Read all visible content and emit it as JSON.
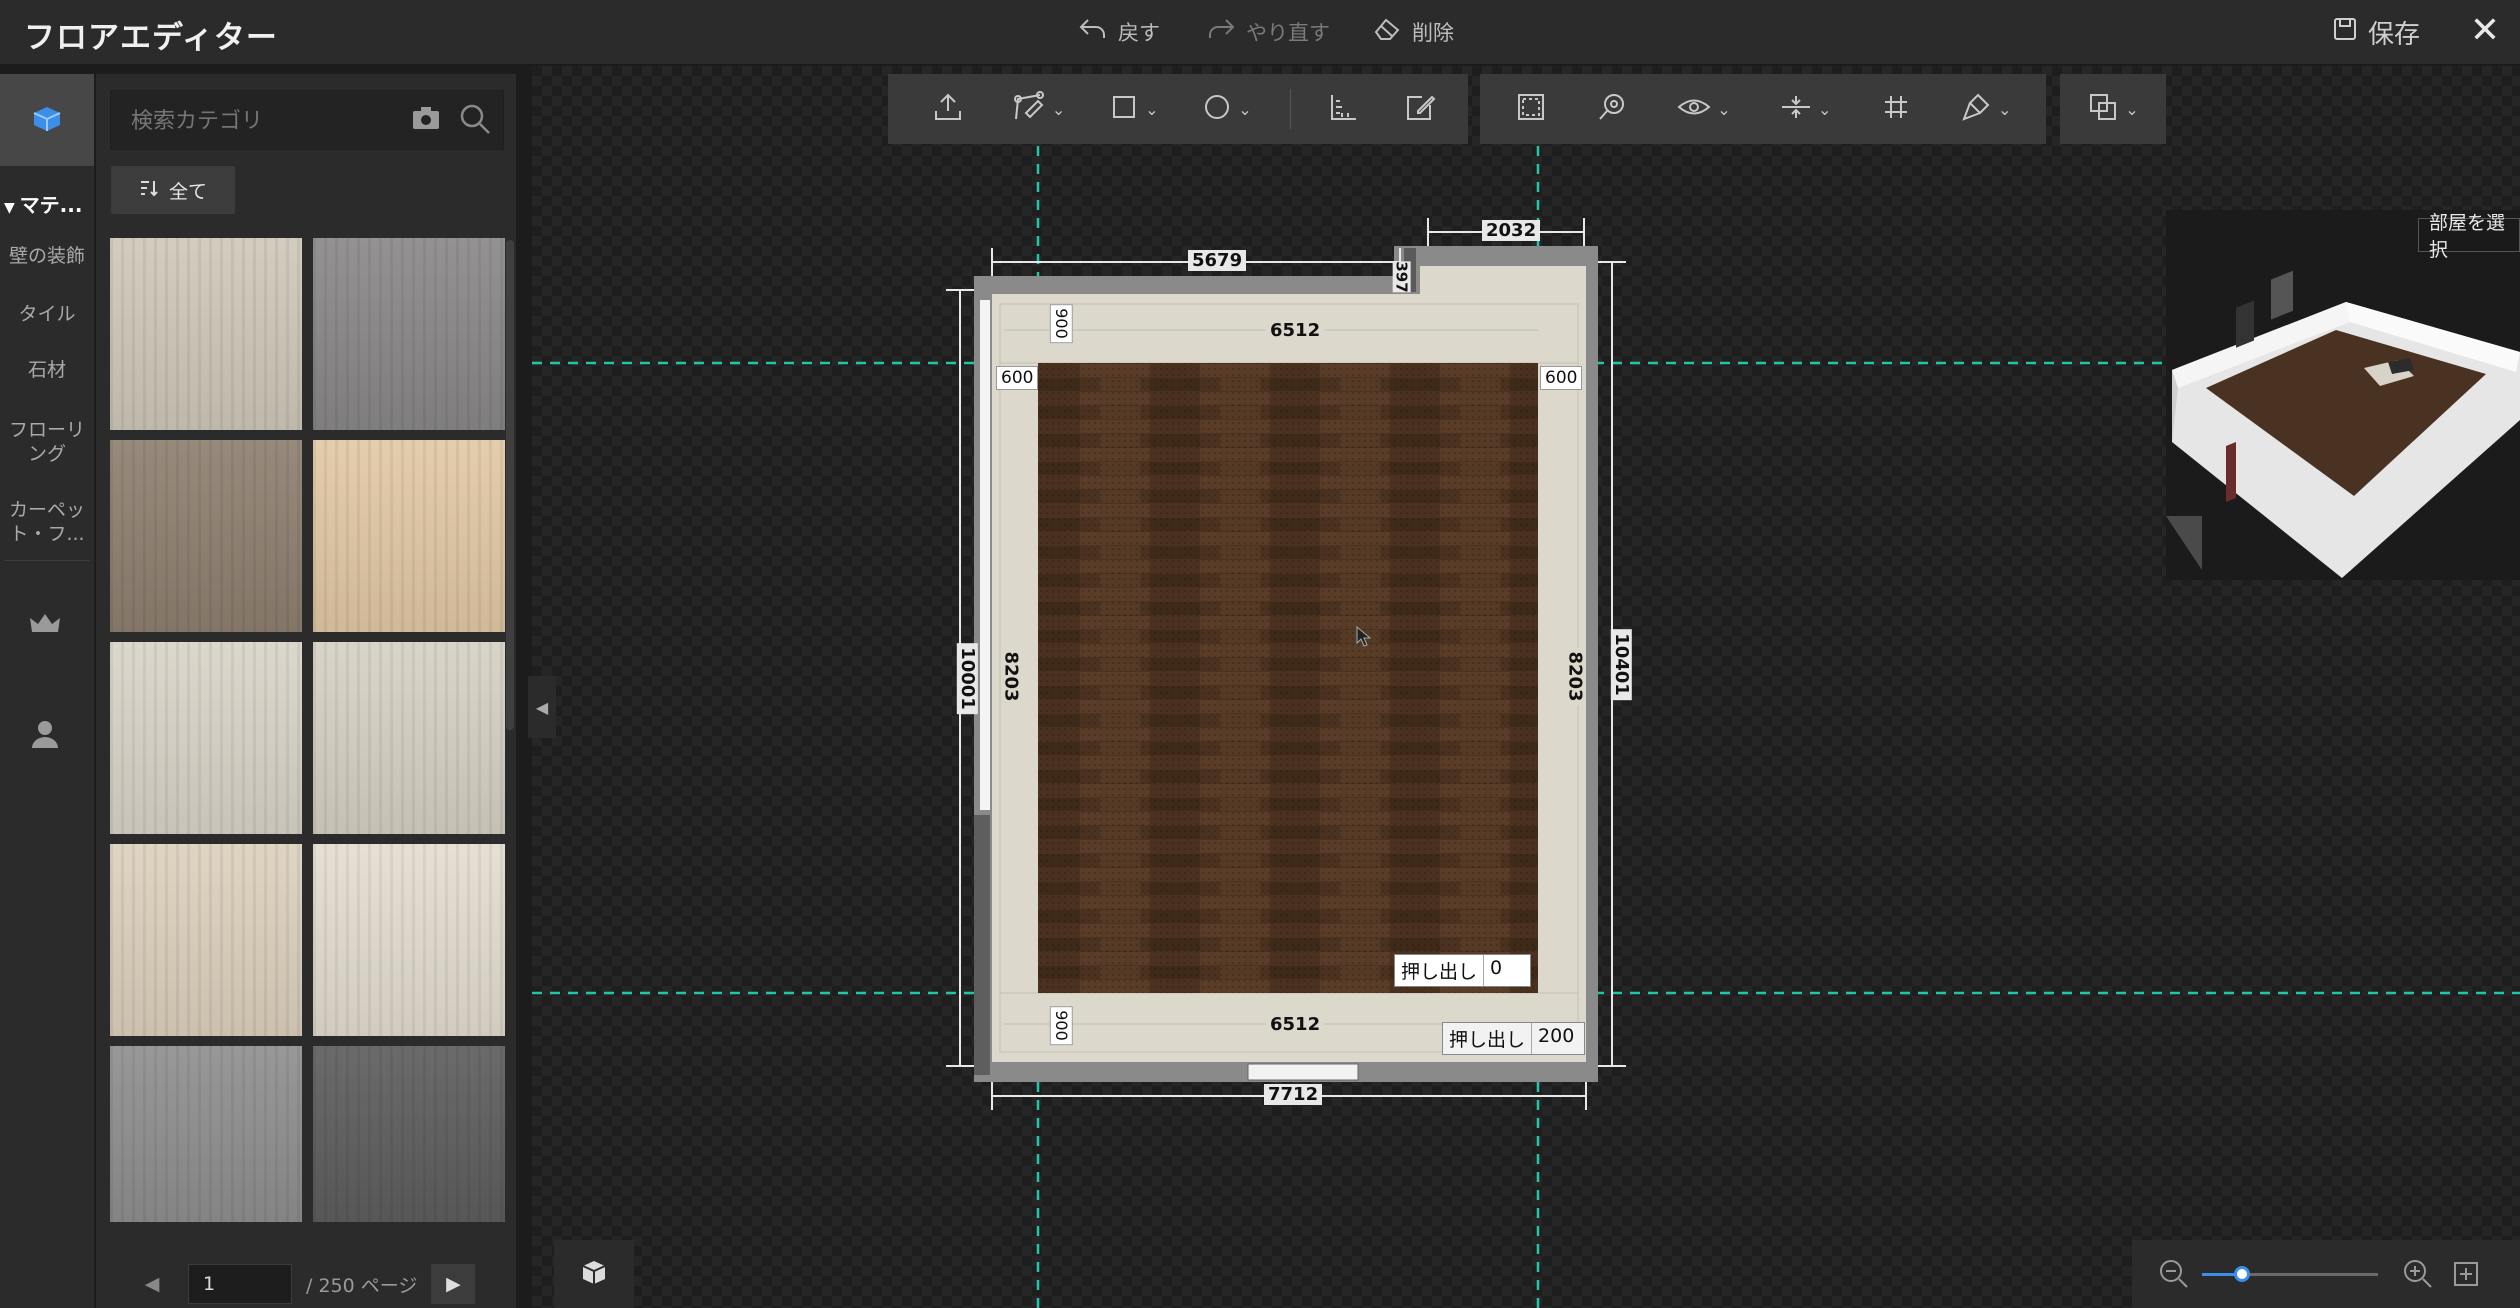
{
  "app": {
    "title": "フロアエディター"
  },
  "topbar": {
    "undo": "戻す",
    "redo": "やり直す",
    "delete": "削除",
    "save": "保存",
    "close": "✕"
  },
  "sidebar": {
    "categories": [
      {
        "label": "マテ..."
      },
      {
        "label": "壁の装飾"
      },
      {
        "label": "タイル"
      },
      {
        "label": "石材"
      },
      {
        "label": "フローリ\nング"
      },
      {
        "label": "カーペッ\nト・フ..."
      }
    ]
  },
  "materials": {
    "search_placeholder": "検索カテゴリ",
    "filter_label": "全て",
    "tiles": [
      {
        "name": "light-wood",
        "color": "#cfc8ba"
      },
      {
        "name": "gray-fabric",
        "color": "#8a8888"
      },
      {
        "name": "rustic-wood",
        "color": "#8e8070"
      },
      {
        "name": "birch-wood",
        "color": "#e2c9a5"
      },
      {
        "name": "beige-marble",
        "color": "#d9d4c8"
      },
      {
        "name": "pale-wood",
        "color": "#d6d1c4"
      },
      {
        "name": "travertine",
        "color": "#ddd0bd"
      },
      {
        "name": "check-tile",
        "color": "#e4ddd0"
      },
      {
        "name": "gray-stone",
        "color": "#8f8f8f"
      },
      {
        "name": "dark-check",
        "color": "#5e5e5e"
      }
    ],
    "page_current": "1",
    "page_total": "/ 250 ページ"
  },
  "plan": {
    "dims": {
      "top_left": "5679",
      "top_right": "2032",
      "notch": "397",
      "inner_top": "6512",
      "inner_bottom": "6512",
      "bottom": "7712",
      "left_outer": "10001",
      "right_outer": "10401",
      "left_inner": "8203",
      "right_inner": "8203",
      "left_offset": "600",
      "right_offset": "600",
      "top_offset": "900",
      "bottom_offset": "900"
    },
    "extrude_label": "押し出し",
    "extrude_inner": "0",
    "extrude_outer": "200"
  },
  "preview": {
    "tooltip": "部屋を選択"
  }
}
